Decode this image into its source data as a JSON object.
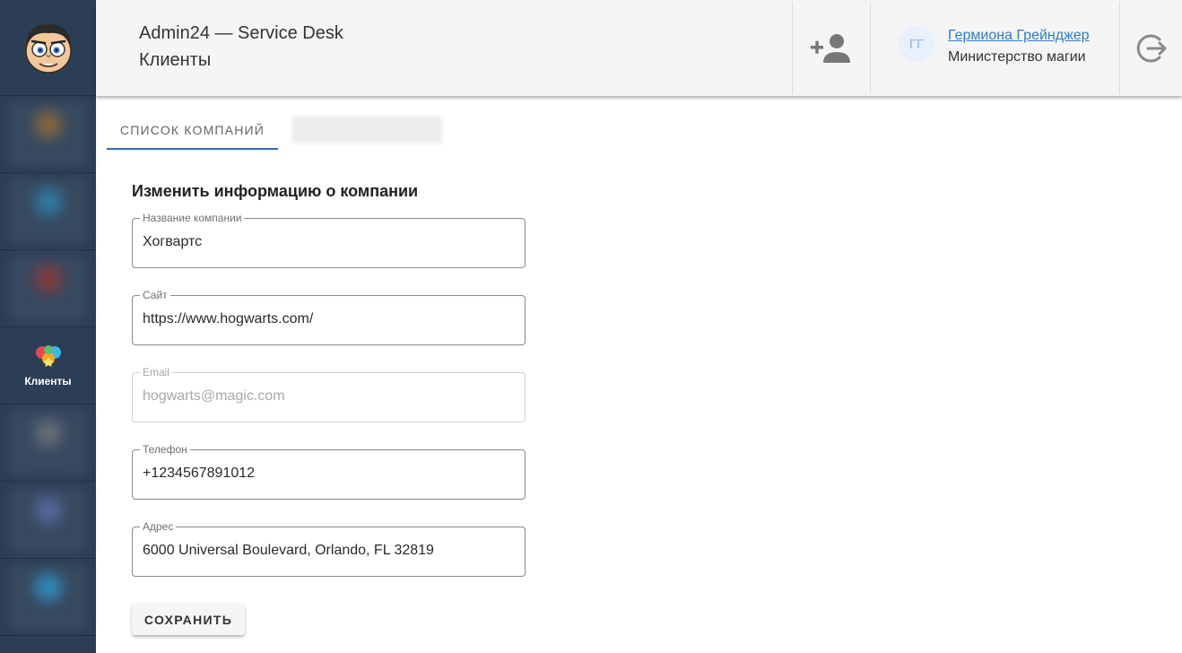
{
  "header": {
    "app_title": "Admin24 — Service Desk",
    "page_title": "Клиенты",
    "add_user_icon": "add-user-icon",
    "user": {
      "initials": "ГГ",
      "name": "Гермиона Грейнджер",
      "organization": "Министерство магии"
    },
    "logout_icon": "logout-icon"
  },
  "sidebar": {
    "logo_icon": "cartoon-face-logo",
    "items": [
      {
        "label": "",
        "blurred": true,
        "color": "#8a6a3a"
      },
      {
        "label": "",
        "blurred": true,
        "color": "#2f7fa8"
      },
      {
        "label": "",
        "blurred": true,
        "color": "#8a3a3a"
      },
      {
        "label": "Клиенты",
        "blurred": false,
        "icon": "clients-icon"
      },
      {
        "label": "",
        "blurred": true,
        "color": "#6b7078"
      },
      {
        "label": "",
        "blurred": true,
        "color": "#5a6aa0"
      },
      {
        "label": "",
        "blurred": true,
        "color": "#2f8fbf"
      }
    ]
  },
  "tabs": [
    {
      "label": "СПИСОК КОМПАНИЙ",
      "active": true
    },
    {
      "label": "",
      "blurred": true
    }
  ],
  "form": {
    "title": "Изменить информацию о компании",
    "fields": [
      {
        "label": "Название компании",
        "value": "Хогвартс",
        "disabled": false
      },
      {
        "label": "Сайт",
        "value": "https://www.hogwarts.com/",
        "disabled": false
      },
      {
        "label": "Email",
        "value": "hogwarts@magic.com",
        "disabled": true
      },
      {
        "label": "Телефон",
        "value": "+1234567891012",
        "disabled": false
      },
      {
        "label": "Адрес",
        "value": "6000 Universal Boulevard, Orlando, FL 32819",
        "disabled": false
      }
    ],
    "save_label": "СОХРАНИТЬ"
  },
  "colors": {
    "sidebar_bg": "#2c3e55",
    "accent": "#2f6fb4",
    "link": "#2f7cc4"
  }
}
